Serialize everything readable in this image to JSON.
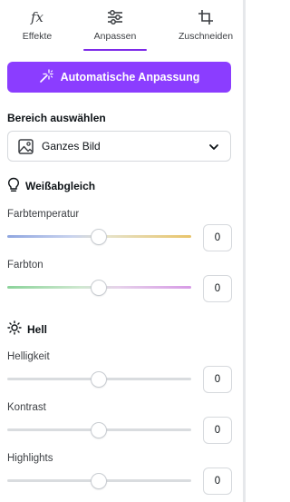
{
  "tabs": [
    {
      "label": "Effekte",
      "icon": "fx-icon"
    },
    {
      "label": "Anpassen",
      "icon": "sliders-icon",
      "active": true
    },
    {
      "label": "Zuschneiden",
      "icon": "crop-icon"
    }
  ],
  "auto_adjust": {
    "label": "Automatische Anpassung",
    "icon": "magic-wand-icon",
    "color": "#8b3dff"
  },
  "area": {
    "title": "Bereich auswählen",
    "value": "Ganzes Bild"
  },
  "white_balance": {
    "title": "Weißabgleich",
    "sliders": [
      {
        "label": "Farbtemperatur",
        "value": "0"
      },
      {
        "label": "Farbton",
        "value": "0"
      }
    ]
  },
  "light": {
    "title": "Hell",
    "sliders": [
      {
        "label": "Helligkeit",
        "value": "0"
      },
      {
        "label": "Kontrast",
        "value": "0"
      },
      {
        "label": "Highlights",
        "value": "0"
      }
    ]
  },
  "accent_color": "#7d2ae8"
}
